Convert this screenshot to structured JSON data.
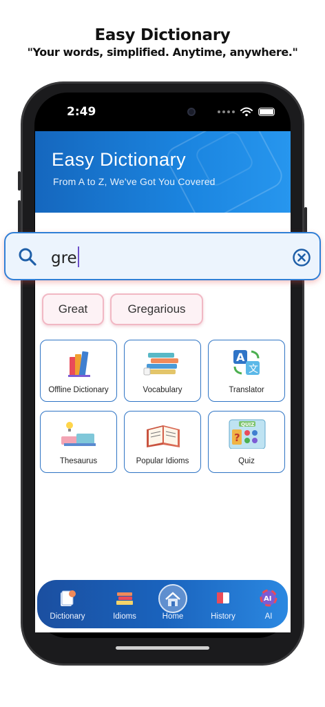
{
  "promo": {
    "title": "Easy Dictionary",
    "subtitle": "\"Your words, simplified. Anytime, anywhere.\""
  },
  "status_bar": {
    "time": "2:49"
  },
  "header": {
    "title": "Easy Dictionary",
    "tagline": "From A to Z, We've Got You Covered"
  },
  "search": {
    "value": "gre",
    "icon": "search-icon",
    "clear_icon": "close-circle-icon"
  },
  "suggestions": [
    "Great",
    "Gregarious"
  ],
  "features": [
    {
      "label": "Offline Dictionary",
      "icon": "books-icon"
    },
    {
      "label": "Vocabulary",
      "icon": "book-stack-icon"
    },
    {
      "label": "Translator",
      "icon": "translate-icon"
    },
    {
      "label": "Thesaurus",
      "icon": "thesaurus-icon"
    },
    {
      "label": "Popular Idioms",
      "icon": "open-book-icon"
    },
    {
      "label": "Quiz",
      "icon": "quiz-icon"
    }
  ],
  "nav": {
    "items": [
      {
        "label": "Dictionary",
        "icon": "dictionary-icon"
      },
      {
        "label": "Idioms",
        "icon": "idioms-icon"
      },
      {
        "label": "Home",
        "icon": "home-icon",
        "active": true
      },
      {
        "label": "History",
        "icon": "history-icon"
      },
      {
        "label": "AI",
        "icon": "ai-icon"
      }
    ]
  },
  "colors": {
    "header_start": "#1567be",
    "header_end": "#2796ee",
    "card_border": "#2d73c4",
    "chip_border": "#f1b8c4",
    "nav_start": "#1b4fa0",
    "nav_end": "#2b88e1"
  }
}
